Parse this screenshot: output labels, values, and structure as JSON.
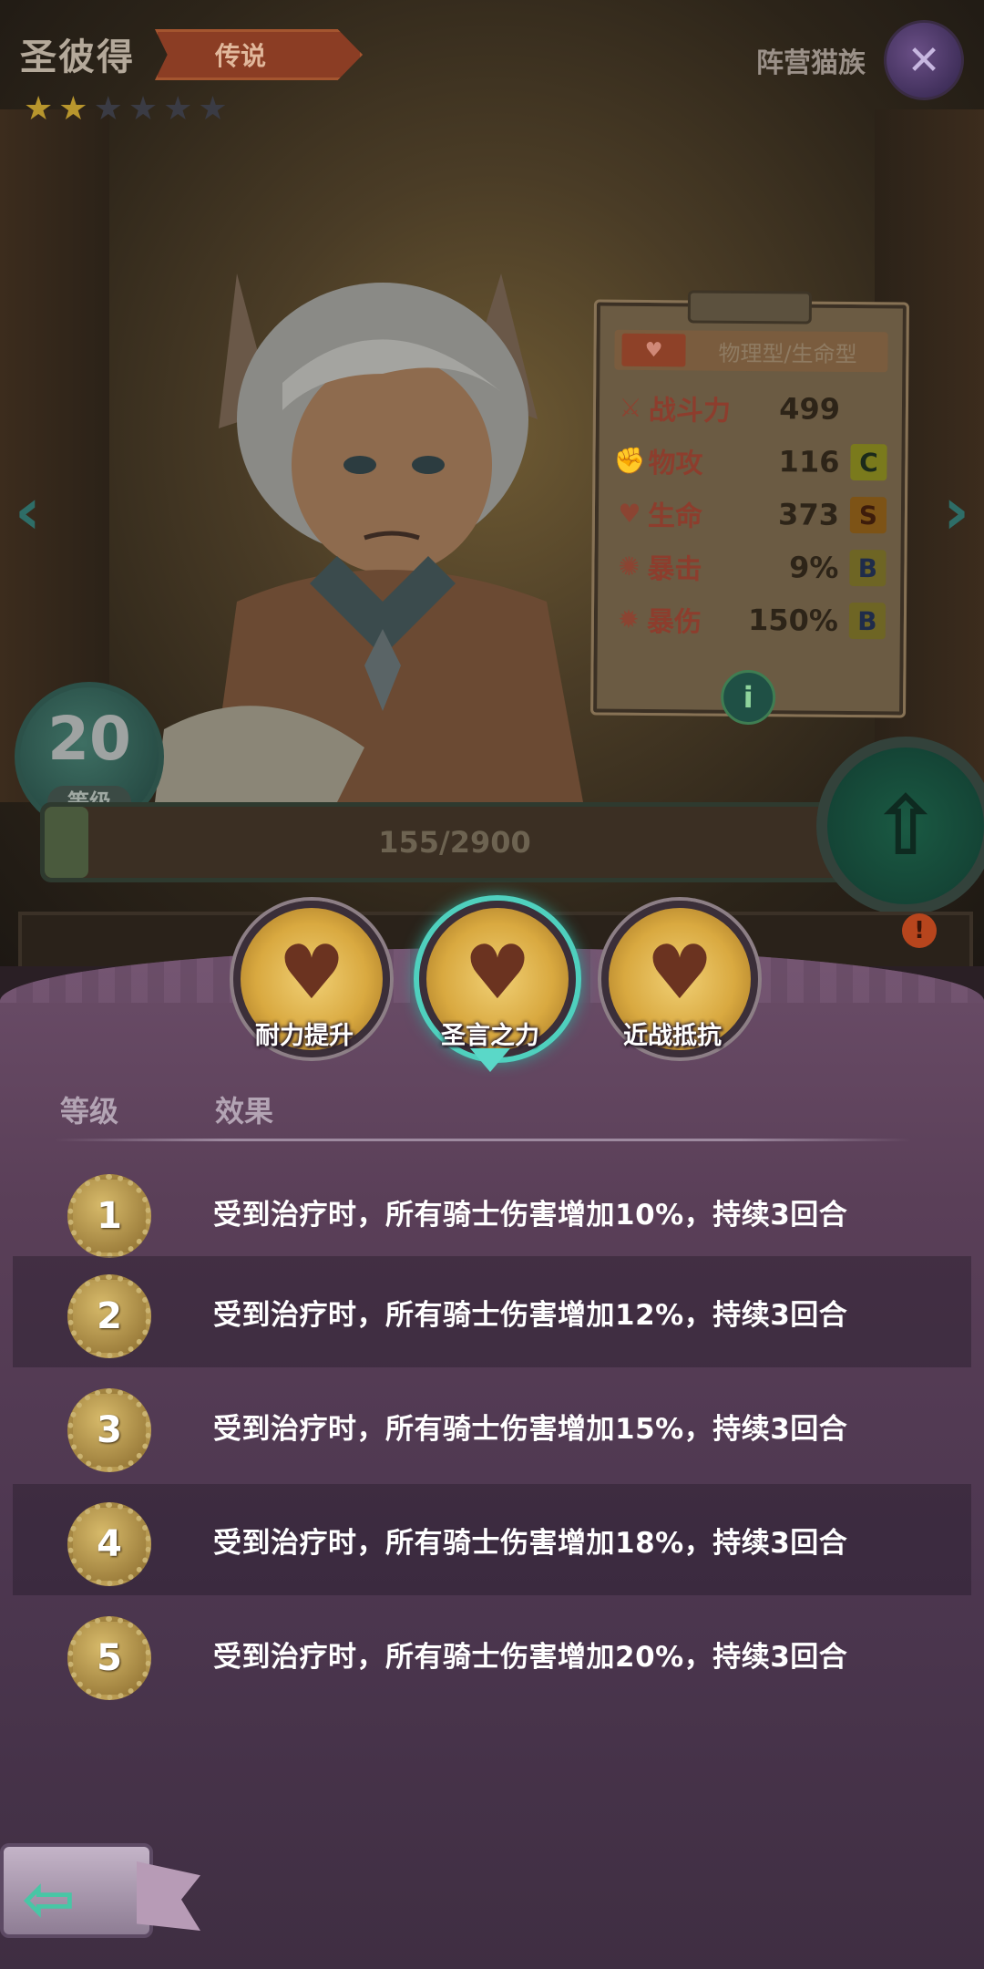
{
  "hero": {
    "name": "圣彼得",
    "rarity": "传说",
    "stars_filled": 2,
    "stars_total": 6,
    "faction": "阵营猫族",
    "faction_icon": "fish-bone-icon",
    "level": "20",
    "level_label": "等级",
    "exp_text": "155/2900",
    "exp_fraction": 0.053
  },
  "stats": {
    "type": "物理型/生命型",
    "rows": [
      {
        "icon": "power-icon",
        "label": "战斗力",
        "value": "499",
        "grade": ""
      },
      {
        "icon": "fist-icon",
        "label": "物攻",
        "value": "116",
        "grade": "C"
      },
      {
        "icon": "heart-icon",
        "label": "生命",
        "value": "373",
        "grade": "S"
      },
      {
        "icon": "crit-icon",
        "label": "暴击",
        "value": "9%",
        "grade": "B"
      },
      {
        "icon": "crit-damage-icon",
        "label": "暴伤",
        "value": "150%",
        "grade": "B"
      }
    ]
  },
  "skills": [
    {
      "name": "耐力提升",
      "active": false
    },
    {
      "name": "圣言之力",
      "active": true
    },
    {
      "name": "近战抵抗",
      "active": false
    }
  ],
  "table": {
    "col_level": "等级",
    "col_effect": "效果",
    "rows": [
      {
        "level": "1",
        "effect": "受到治疗时，所有骑士伤害增加10%，持续3回合"
      },
      {
        "level": "2",
        "effect": "受到治疗时，所有骑士伤害增加12%，持续3回合"
      },
      {
        "level": "3",
        "effect": "受到治疗时，所有骑士伤害增加15%，持续3回合"
      },
      {
        "level": "4",
        "effect": "受到治疗时，所有骑士伤害增加18%，持续3回合"
      },
      {
        "level": "5",
        "effect": "受到治疗时，所有骑士伤害增加20%，持续3回合"
      }
    ]
  },
  "colors": {
    "panel": "#5a3f58",
    "accent": "#4fd0be",
    "gold": "#d9a940"
  }
}
